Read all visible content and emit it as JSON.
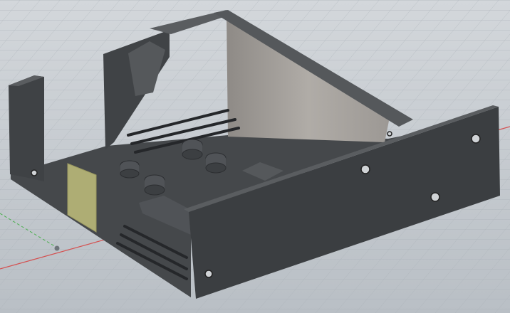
{
  "viewport": {
    "type": "cad-3d-viewport",
    "model": "enclosure-box",
    "colors": {
      "background_top": "#d3d7db",
      "background_bottom": "#b9bfc5",
      "grid": "#a9b0b7",
      "x_axis": "#d45050",
      "z_axis": "#4caf50",
      "body_dark": "#45484b",
      "body_front": "#3b3e41",
      "inner_face": "#a19d99",
      "sketch_plane": "#e6e38a"
    }
  }
}
